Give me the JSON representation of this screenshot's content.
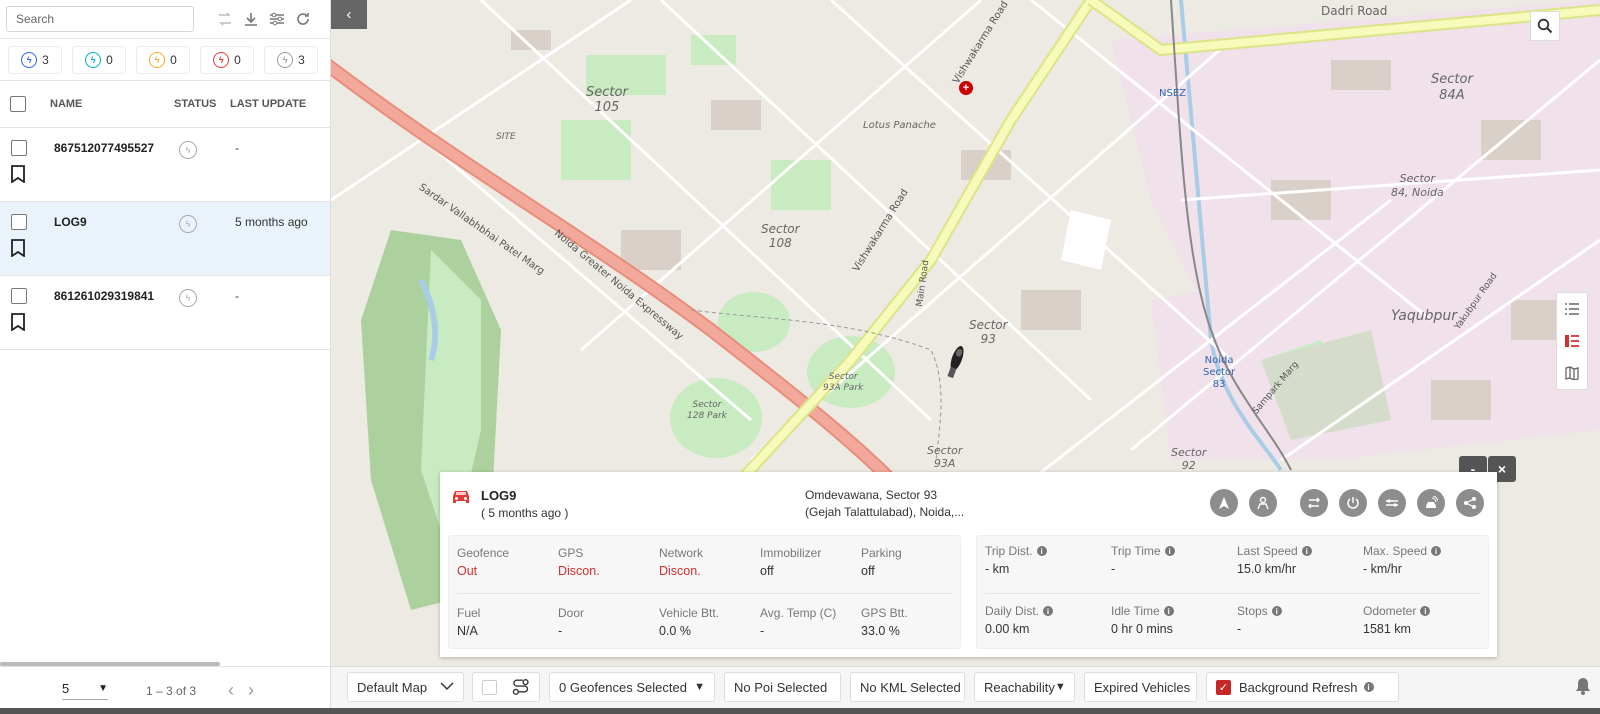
{
  "sidebar": {
    "search_placeholder": "Search",
    "status_chips": [
      {
        "count": "3",
        "color": "#2962ff"
      },
      {
        "count": "0",
        "color": "#00acc1"
      },
      {
        "count": "0",
        "color": "#f9a825"
      },
      {
        "count": "0",
        "color": "#e53935"
      },
      {
        "count": "3",
        "color": "#9e9e9e"
      }
    ],
    "columns": {
      "name": "NAME",
      "status": "STATUS",
      "last_update": "LAST UPDATE"
    },
    "rows": [
      {
        "name": "867512077495527",
        "last_update": "-"
      },
      {
        "name": "LOG9",
        "last_update": "5 months ago"
      },
      {
        "name": "861261029319841",
        "last_update": "-"
      }
    ],
    "pager": {
      "page_size": "5",
      "range": "1 – 3 of 3"
    }
  },
  "map": {
    "labels": {
      "sector105": "Sector\n105",
      "sector108": "Sector\n108",
      "sector93": "Sector\n93",
      "sector84a": "Sector\n84A",
      "sector84": "Sector\n84, Noida",
      "yaqubpur": "Yaqubpur",
      "dadri_road": "Dadri Road",
      "lotus_panache": "Lotus Panache",
      "vishwakarma_road": "Vishwakarma Road",
      "noida_expressway": "Noida Greater Noida Expressway",
      "sardar_marg": "Sardar Vallabhbhai Patel Marg",
      "nsez": "NSEZ",
      "site": "SITE",
      "sector93a_park": "Sector\n93A Park",
      "sector128_park": "Sector\n128 Park",
      "noida_sector83": "Noida\nSector\n83",
      "sector93a": "Sector\n93A",
      "sector92": "Sector\n92",
      "sampark_marg": "Sampark Marg",
      "main_road": "Main Road",
      "yakubpur_road": "Yakubpur Road"
    }
  },
  "vehicle_card": {
    "name": "LOG9",
    "ago": "( 5 months ago )",
    "address_line1": "Omdevawana, Sector 93",
    "address_line2": "(Gejah Talattulabad), Noida,...",
    "left_metrics": [
      {
        "label": "Geofence",
        "value": "Out",
        "alert": true
      },
      {
        "label": "GPS",
        "value": "Discon.",
        "alert": true
      },
      {
        "label": "Network",
        "value": "Discon.",
        "alert": true
      },
      {
        "label": "Immobilizer",
        "value": "off",
        "alert": false
      },
      {
        "label": "Parking",
        "value": "off",
        "alert": false
      },
      {
        "label": "Fuel",
        "value": "N/A",
        "alert": false
      },
      {
        "label": "Door",
        "value": "-",
        "alert": false
      },
      {
        "label": "Vehicle Btt.",
        "value": "0.0 %",
        "alert": false
      },
      {
        "label": "Avg. Temp (C)",
        "value": "-",
        "alert": false
      },
      {
        "label": "GPS Btt.",
        "value": "33.0 %",
        "alert": false
      }
    ],
    "right_metrics": [
      {
        "label": "Trip Dist.",
        "value": "- km"
      },
      {
        "label": "Trip Time",
        "value": "-"
      },
      {
        "label": "Last Speed",
        "value": "15.0 km/hr"
      },
      {
        "label": "Max. Speed",
        "value": "- km/hr"
      },
      {
        "label": "Daily Dist.",
        "value": "0.00 km"
      },
      {
        "label": "Idle Time",
        "value": "0 hr 0 mins"
      },
      {
        "label": "Stops",
        "value": "-"
      },
      {
        "label": "Odometer",
        "value": "1581 km"
      }
    ]
  },
  "bottom_bar": {
    "map_type": "Default Map",
    "geofences": "0 Geofences Selected",
    "poi": "No Poi Selected",
    "kml": "No KML Selected",
    "reachability": "Reachability",
    "expired": "Expired Vehicles",
    "background_refresh": "Background Refresh"
  },
  "icons": [
    "search-icon",
    "route-icon",
    "download-icon",
    "filter-icon",
    "refresh-icon",
    "bookmark-icon",
    "chevron-left-icon",
    "map-search-icon",
    "list-icon",
    "layers-icon",
    "map-icon",
    "car-icon",
    "navigate-icon",
    "driver-icon",
    "trip-icon",
    "power-icon",
    "immobilizer-icon",
    "speed-icon",
    "share-icon",
    "bell-icon",
    "info-icon"
  ]
}
